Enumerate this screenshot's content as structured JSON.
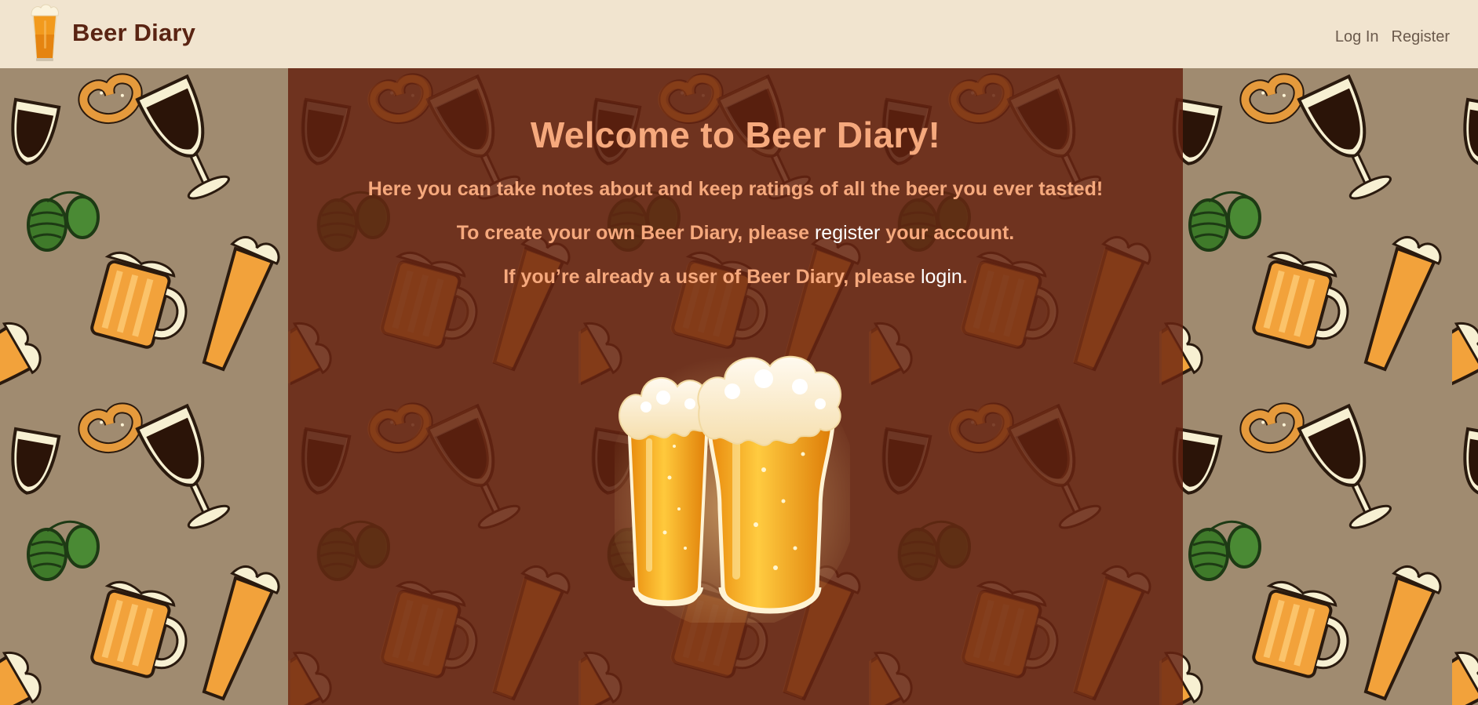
{
  "navbar": {
    "brand_name": "Beer Diary",
    "links": {
      "login": "Log In",
      "register": "Register"
    }
  },
  "welcome": {
    "title": "Welcome to Beer Diary!",
    "tagline": "Here you can take notes about and keep ratings of all the beer you ever tasted!",
    "register_prefix": "To create your own Beer Diary, please",
    "register_link": "register",
    "register_suffix": "your account.",
    "login_prefix": "If you’re already a user of Beer Diary, please",
    "login_link": "login",
    "login_suffix": "."
  },
  "icons": {
    "brand_logo": "beer-glass-icon",
    "hero": "two-beer-glasses-illustration",
    "background": "beer-mugs-pretzels-hops-pattern"
  },
  "colors": {
    "navbar_bg": "#f1e4cf",
    "brand_text": "#5a2413",
    "nav_link": "#6b5a4c",
    "panel_bg": "#662412",
    "heading_text": "#f6a97d",
    "link_text": "#ffffff",
    "pattern_bg": "#a08b70"
  }
}
